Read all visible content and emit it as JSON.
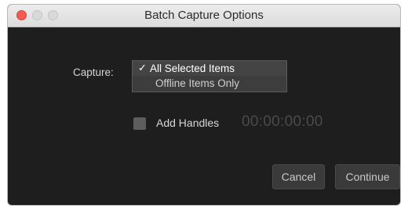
{
  "window": {
    "title": "Batch Capture Options"
  },
  "capture": {
    "label": "Capture:",
    "options": [
      {
        "label": "All Selected Items",
        "selected": true,
        "check_glyph": "✓"
      },
      {
        "label": "Offline Items Only",
        "selected": false
      }
    ]
  },
  "handles": {
    "label": "Add Handles",
    "checked": false,
    "timecode": "00:00:00:00"
  },
  "buttons": {
    "cancel_label": "Cancel",
    "continue_label": "Continue"
  }
}
